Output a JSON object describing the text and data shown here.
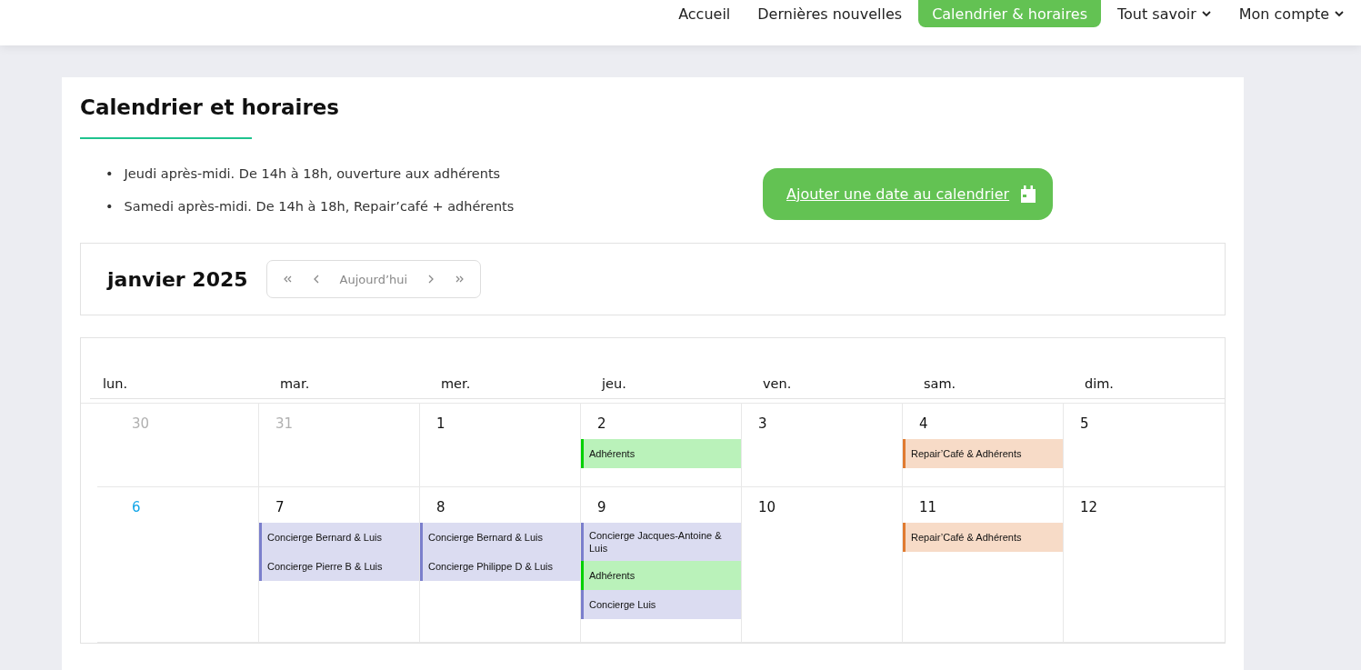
{
  "nav": {
    "items": [
      {
        "label": "Accueil",
        "selected": false,
        "dropdown": false
      },
      {
        "label": "Dernières nouvelles",
        "selected": false,
        "dropdown": false
      },
      {
        "label": "Calendrier & horaires",
        "selected": true,
        "dropdown": false
      },
      {
        "label": "Tout savoir",
        "selected": false,
        "dropdown": true
      },
      {
        "label": "Mon compte",
        "selected": false,
        "dropdown": true
      }
    ]
  },
  "page": {
    "title": "Calendrier et horaires",
    "hours": [
      {
        "bullet": "•",
        "text": "Jeudi après-midi. De 14h à 18h, ouverture aux adhérents"
      },
      {
        "bullet": "•",
        "text": "Samedi après-midi. De 14h à 18h, Repair’café + adhérents"
      }
    ],
    "add_button": "Ajouter une date au calendrier"
  },
  "calendar": {
    "month": "janvier 2025",
    "today_button": "Aujourd’hui",
    "weekdays": [
      "lun.",
      "mar.",
      "mer.",
      "jeu.",
      "ven.",
      "sam.",
      "dim."
    ],
    "weeks": [
      [
        {
          "day": "30",
          "kind": "other"
        },
        {
          "day": "31",
          "kind": "other"
        },
        {
          "day": "1",
          "kind": "normal"
        },
        {
          "day": "2",
          "kind": "normal",
          "events": [
            {
              "title": "Adhérents",
              "color": "#00d000"
            }
          ]
        },
        {
          "day": "3",
          "kind": "normal"
        },
        {
          "day": "4",
          "kind": "normal",
          "events": [
            {
              "title": "Repair’Café & Adhérents",
              "color": "#e07b30"
            }
          ]
        },
        {
          "day": "5",
          "kind": "normal"
        }
      ],
      [
        {
          "day": "6",
          "kind": "today"
        },
        {
          "day": "7",
          "kind": "normal",
          "events": [
            {
              "title": "Concierge Bernard & Luis",
              "color": "#7b7fcc"
            },
            {
              "title": "Concierge Pierre B & Luis",
              "color": "#7b7fcc"
            }
          ]
        },
        {
          "day": "8",
          "kind": "normal",
          "events": [
            {
              "title": "Concierge Bernard & Luis",
              "color": "#7b7fcc"
            },
            {
              "title": "Concierge Philippe D & Luis",
              "color": "#7b7fcc"
            }
          ]
        },
        {
          "day": "9",
          "kind": "normal",
          "events": [
            {
              "title": "Concierge Jacques-Antoine & Luis",
              "color": "#7b7fcc"
            },
            {
              "title": "Adhérents",
              "color": "#00d000"
            },
            {
              "title": "Concierge Luis",
              "color": "#7b7fcc"
            }
          ]
        },
        {
          "day": "10",
          "kind": "normal"
        },
        {
          "day": "11",
          "kind": "normal",
          "events": [
            {
              "title": "Repair’Café & Adhérents",
              "color": "#e07b30"
            }
          ]
        },
        {
          "day": "12",
          "kind": "normal"
        }
      ]
    ]
  }
}
